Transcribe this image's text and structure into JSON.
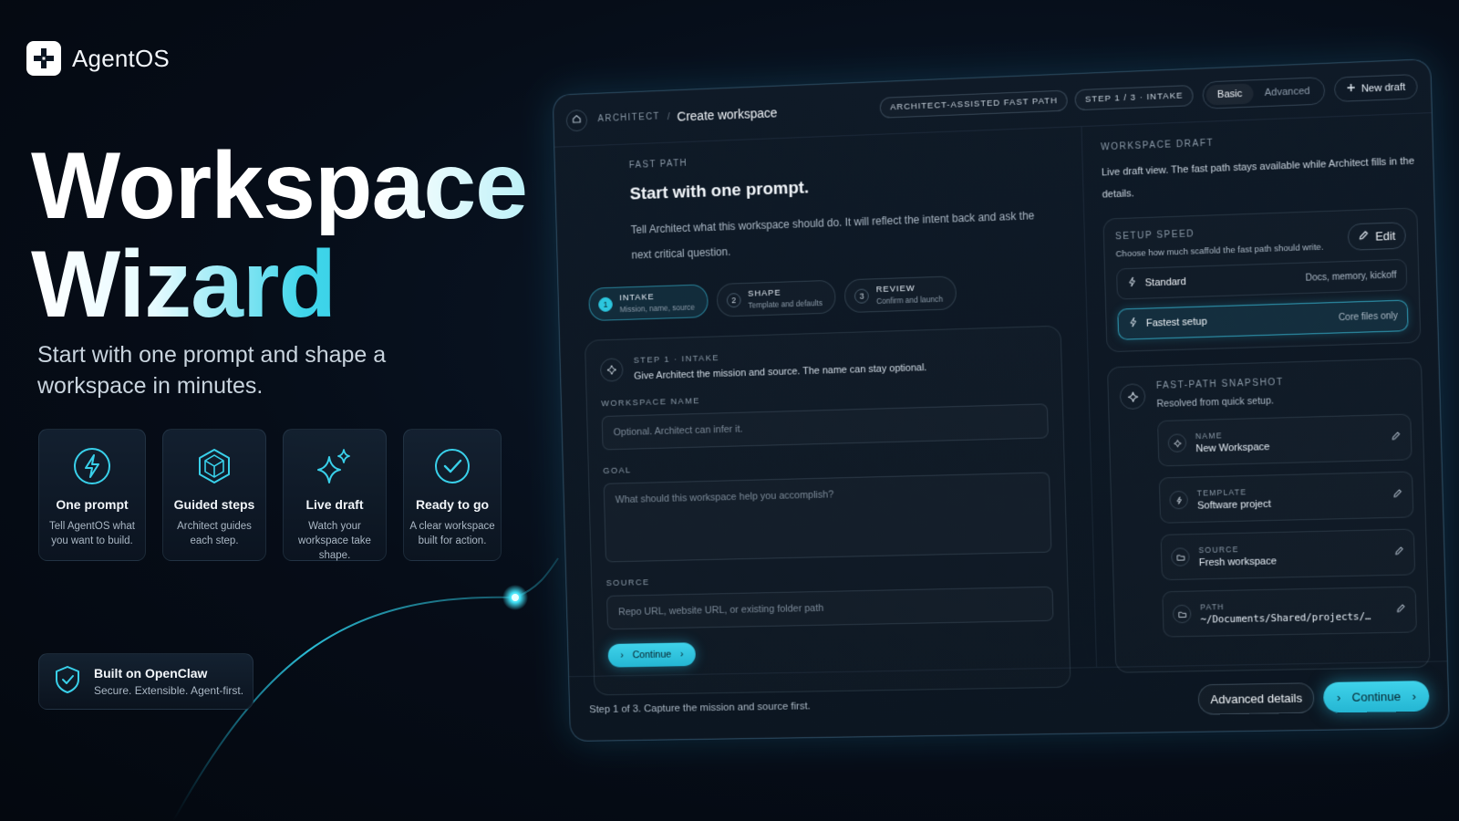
{
  "brand": {
    "name": "AgentOS"
  },
  "hero": {
    "title_line1": "Workspace",
    "title_line2": "Wizard",
    "subtitle": "Start with one prompt and shape a workspace in minutes."
  },
  "features": [
    {
      "icon": "lightning-icon",
      "title": "One prompt",
      "desc": "Tell AgentOS what you want to build."
    },
    {
      "icon": "cube-icon",
      "title": "Guided steps",
      "desc": "Architect guides each step."
    },
    {
      "icon": "sparkle-icon",
      "title": "Live draft",
      "desc": "Watch your workspace take shape."
    },
    {
      "icon": "check-circle-icon",
      "title": "Ready to go",
      "desc": "A clear workspace built for action."
    }
  ],
  "built": {
    "title": "Built on OpenClaw",
    "subtitle": "Secure. Extensible. Agent-first."
  },
  "window": {
    "breadcrumb_root": "ARCHITECT",
    "breadcrumb_sep": "/",
    "breadcrumb_current": "Create workspace",
    "pill_mode": "ARCHITECT-ASSISTED FAST PATH",
    "pill_step": "STEP 1 / 3 · INTAKE",
    "mode_basic": "Basic",
    "mode_advanced": "Advanced",
    "new_draft": "New draft"
  },
  "fast_path": {
    "eyebrow": "FAST PATH",
    "heading": "Start with one prompt.",
    "description": "Tell Architect what this workspace should do. It will reflect the intent back and ask the next critical question."
  },
  "steps": [
    {
      "num": "1",
      "title": "INTAKE",
      "desc": "Mission, name, source",
      "active": true
    },
    {
      "num": "2",
      "title": "SHAPE",
      "desc": "Template and defaults",
      "active": false
    },
    {
      "num": "3",
      "title": "REVIEW",
      "desc": "Confirm and launch",
      "active": false
    }
  ],
  "form": {
    "step_label": "STEP 1 · INTAKE",
    "step_desc": "Give Architect the mission and source. The name can stay optional.",
    "name_label": "WORKSPACE NAME",
    "name_placeholder": "Optional. Architect can infer it.",
    "goal_label": "GOAL",
    "goal_placeholder": "What should this workspace help you accomplish?",
    "source_label": "SOURCE",
    "source_placeholder": "Repo URL, website URL, or existing folder path",
    "continue": "Continue"
  },
  "footer": {
    "status": "Step 1 of 3. Capture the mission and source first.",
    "advanced": "Advanced details",
    "continue": "Continue"
  },
  "draft": {
    "eyebrow": "WORKSPACE DRAFT",
    "description": "Live draft view. The fast path stays available while Architect fills in the details.",
    "speed": {
      "label": "SETUP SPEED",
      "desc": "Choose how much scaffold the fast path should write.",
      "edit": "Edit",
      "options": [
        {
          "name": "Standard",
          "detail": "Docs, memory, kickoff",
          "selected": false
        },
        {
          "name": "Fastest setup",
          "detail": "Core files only",
          "selected": true
        }
      ]
    },
    "snapshot": {
      "label": "FAST-PATH SNAPSHOT",
      "desc": "Resolved from quick setup.",
      "rows": [
        {
          "label": "NAME",
          "value": "New Workspace",
          "icon": "sparkle-icon"
        },
        {
          "label": "TEMPLATE",
          "value": "Software project",
          "icon": "lightning-icon"
        },
        {
          "label": "SOURCE",
          "value": "Fresh workspace",
          "icon": "folder-icon"
        },
        {
          "label": "PATH",
          "value": "~/Documents/Shared/projects/…",
          "icon": "folder-icon"
        }
      ]
    }
  },
  "colors": {
    "accent": "#2cc6de",
    "background": "#060d18"
  }
}
